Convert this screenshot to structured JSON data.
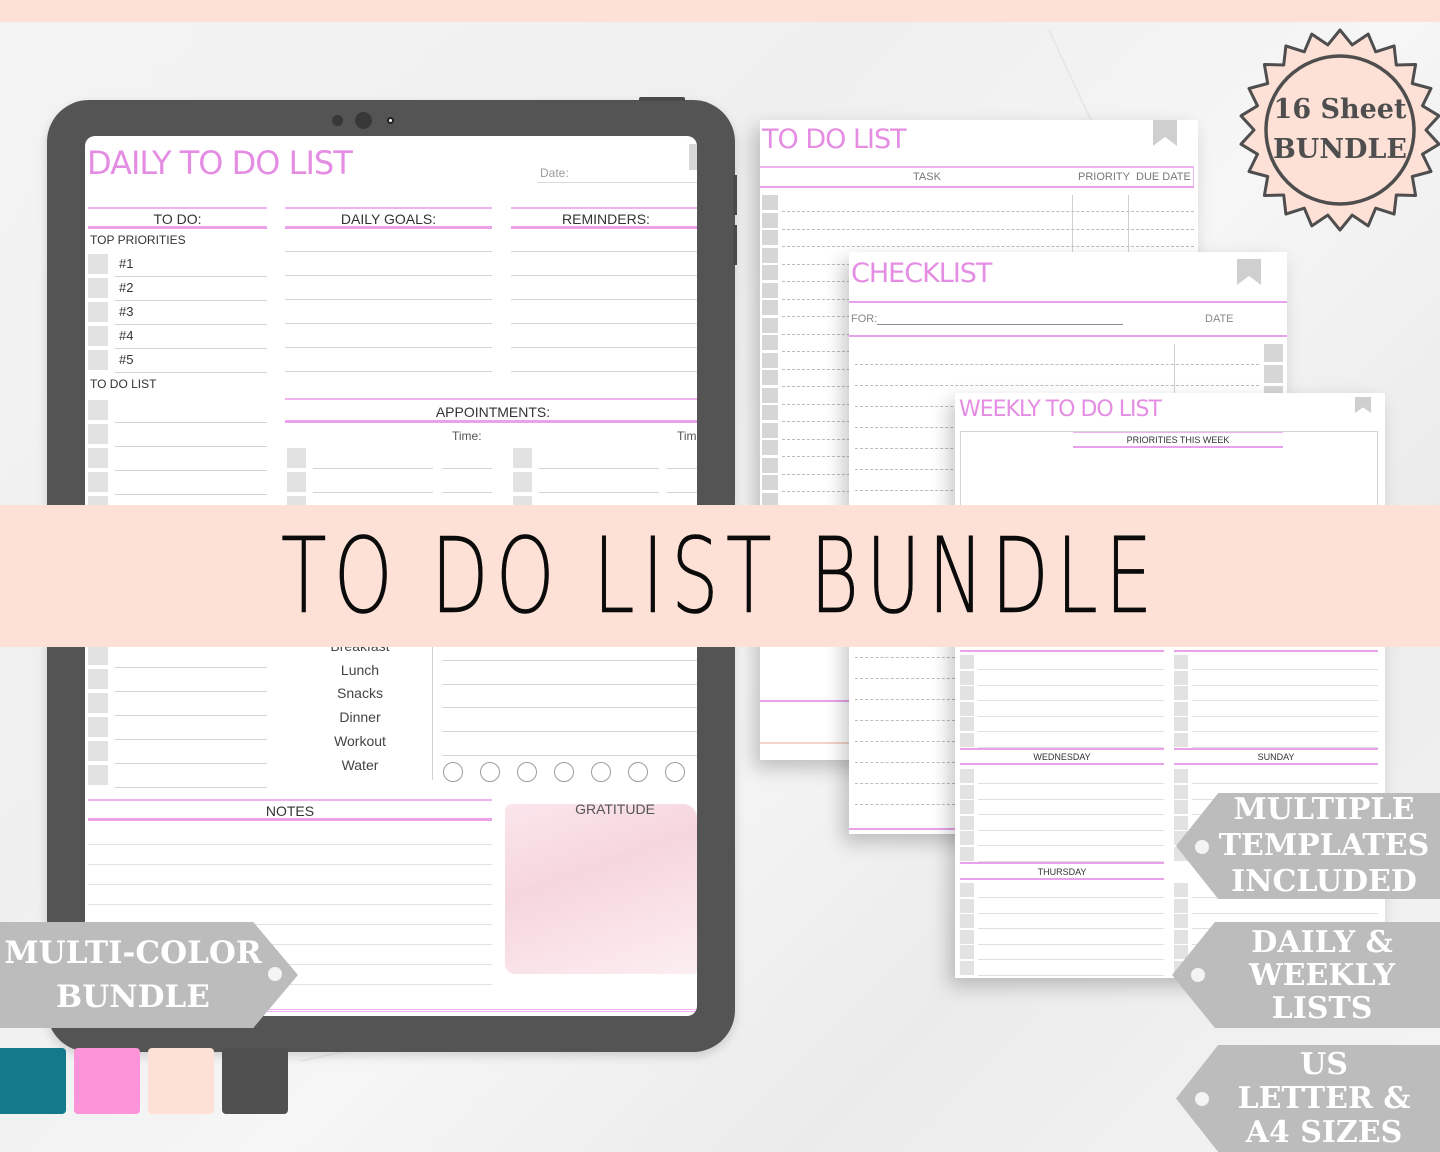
{
  "banner": {
    "title": "TO DO LIST BUNDLE"
  },
  "seal": {
    "line1": "16 Sheet",
    "line2": "BUNDLE"
  },
  "daily_sheet": {
    "title": "DAILY TO DO LIST",
    "date_label": "Date:",
    "columns": {
      "todo": "TO DO:",
      "goals": "DAILY GOALS:",
      "reminders": "REMINDERS:"
    },
    "top_priorities_label": "TOP PRIORITIES",
    "priorities": [
      "#1",
      "#2",
      "#3",
      "#4",
      "#5"
    ],
    "todo_list_label": "TO DO LIST",
    "appointments_label": "APPOINTMENTS:",
    "time_label": "Time:",
    "time_label_cut": "Tim",
    "meals": [
      "Breakfast",
      "Lunch",
      "Snacks",
      "Dinner",
      "Workout",
      "Water"
    ],
    "water_circles": 7,
    "notes_label": "NOTES",
    "gratitude_label": "GRATITUDE"
  },
  "todo_sheet": {
    "title": "TO DO LIST",
    "headers": {
      "task": "TASK",
      "priority": "PRIORITY",
      "due_date": "DUE DATE"
    }
  },
  "checklist_sheet": {
    "title": "CHECKLIST",
    "for_label": "FOR:",
    "date_label": "DATE"
  },
  "weekly_sheet": {
    "title": "WEEKLY TO DO LIST",
    "priorities_label": "PRIORITIES THIS WEEK",
    "days": {
      "wednesday": "WEDNESDAY",
      "sunday": "SUNDAY",
      "thursday": "THURSDAY"
    }
  },
  "tags": {
    "multi_color": [
      "MULTI-COLOR",
      "BUNDLE"
    ],
    "multiple_templates": [
      "MULTIPLE",
      "TEMPLATES",
      "INCLUDED"
    ],
    "daily_weekly": [
      "DAILY &",
      "WEEKLY",
      "LISTS"
    ],
    "sizes": [
      "US",
      "LETTER &",
      "A4 SIZES"
    ]
  },
  "swatches": [
    {
      "name": "teal",
      "color": "#137a8c"
    },
    {
      "name": "pink",
      "color": "#fd93d8"
    },
    {
      "name": "peach",
      "color": "#fde1d6"
    },
    {
      "name": "charcoal",
      "color": "#505050"
    }
  ],
  "colors": {
    "accent_pink": "#e48de3",
    "banner_peach": "#fde1d6",
    "tag_gray": "#bcbcbc",
    "device_gray": "#545454"
  }
}
